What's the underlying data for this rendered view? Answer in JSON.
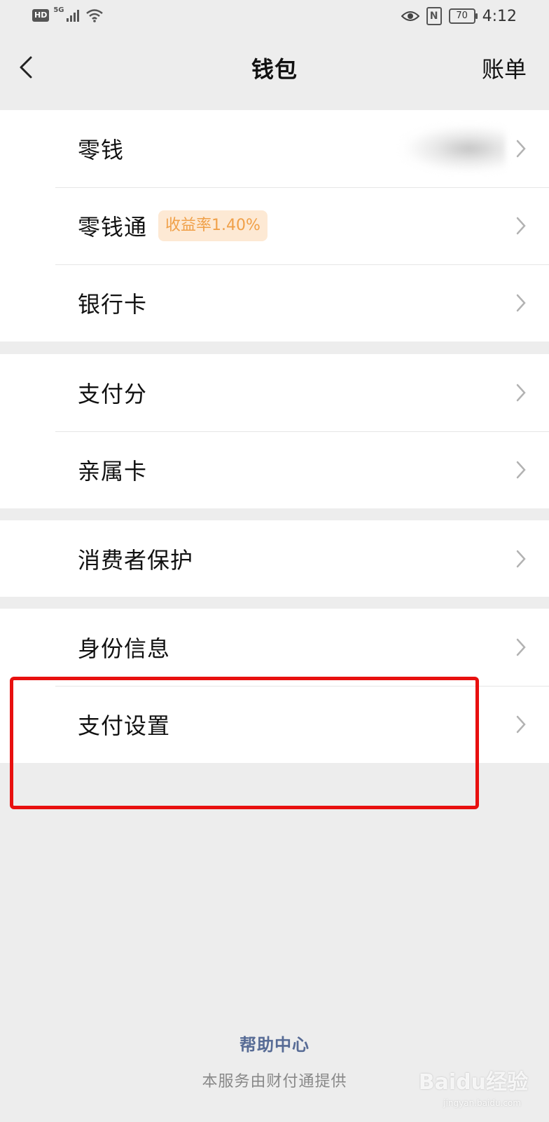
{
  "status_bar": {
    "hd": "HD",
    "network": "5G",
    "battery": "70",
    "time": "4:12"
  },
  "nav": {
    "title": "钱包",
    "right_label": "账单"
  },
  "sections": [
    {
      "items": [
        {
          "label": "零钱"
        },
        {
          "label": "零钱通",
          "badge": "收益率1.40%"
        },
        {
          "label": "银行卡"
        }
      ]
    },
    {
      "items": [
        {
          "label": "支付分"
        },
        {
          "label": "亲属卡"
        }
      ]
    },
    {
      "items": [
        {
          "label": "消费者保护"
        }
      ]
    },
    {
      "items": [
        {
          "label": "身份信息"
        },
        {
          "label": "支付设置"
        }
      ]
    }
  ],
  "footer": {
    "help_center": "帮助中心",
    "provider": "本服务由财付通提供"
  },
  "watermark": {
    "brand": "Baidu经验",
    "url": "jingyan.baidu.com"
  },
  "colors": {
    "highlight": "#e8100f",
    "link": "#576b95",
    "badge_text": "#f0a048",
    "badge_bg": "#fde9d4"
  }
}
